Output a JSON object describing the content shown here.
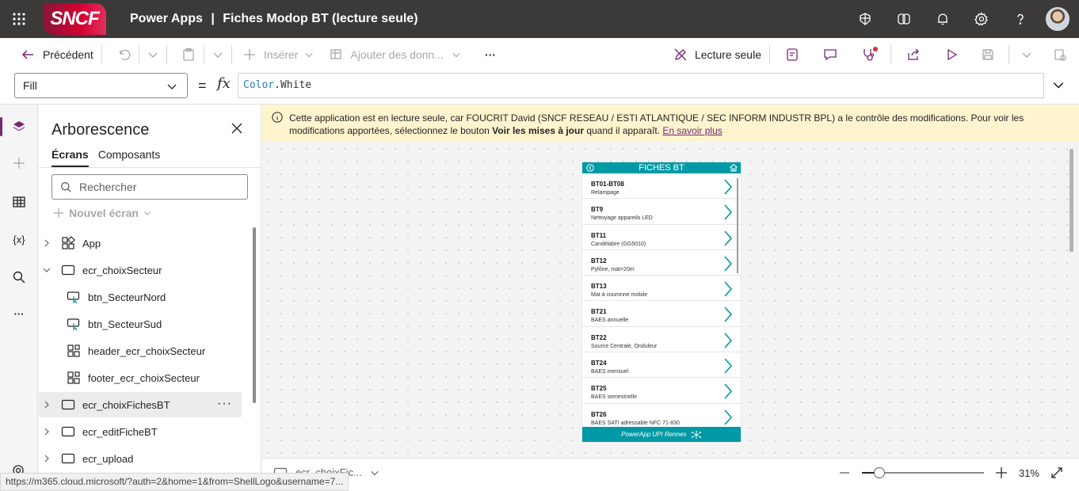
{
  "topbar": {
    "logo_text": "SNCF",
    "app_name": "Power Apps",
    "separator": "|",
    "doc_title": "Fiches Modop BT (lecture seule)"
  },
  "commandbar": {
    "back_label": "Précédent",
    "insert_label": "Insérer",
    "add_data_label": "Ajouter des donn...",
    "more_label": "···",
    "readonly_label": "Lecture seule"
  },
  "formulabar": {
    "property": "Fill",
    "equals": "=",
    "fx": "fx",
    "formula_obj": "Color",
    "formula_rest": ".White"
  },
  "tree": {
    "title": "Arborescence",
    "tabs": [
      "Écrans",
      "Composants"
    ],
    "search_placeholder": "Rechercher",
    "new_screen": "Nouvel écran",
    "nodes": [
      {
        "label": "App"
      },
      {
        "label": "ecr_choixSecteur"
      },
      {
        "label": "btn_SecteurNord"
      },
      {
        "label": "btn_SecteurSud"
      },
      {
        "label": "header_ecr_choixSecteur"
      },
      {
        "label": "footer_ecr_choixSecteur"
      },
      {
        "label": "ecr_choixFichesBT"
      },
      {
        "label": "ecr_editFicheBT"
      },
      {
        "label": "ecr_upload"
      }
    ],
    "more_label": "···"
  },
  "banner": {
    "text_before": "Cette application est en lecture seule, car FOUCRIT David (SNCF RESEAU / ESTI ATLANTIQUE / SEC INFORM INDUSTR BPL) a le contrôle des modifications. Pour voir les modifications apportées, sélectionnez le bouton ",
    "bold": "Voir les mises à jour",
    "text_after": " quand il apparaît. ",
    "link": "En savoir plus"
  },
  "phone": {
    "title": "FICHES BT",
    "footer": "PowerApp UPI Rennes",
    "rows": [
      {
        "code": "BT01-BT08",
        "desc": "Relampage"
      },
      {
        "code": "BT9",
        "desc": "Nettoyage appareils LED"
      },
      {
        "code": "BT11",
        "desc": "Candélabre (GG5010)"
      },
      {
        "code": "BT12",
        "desc": "Pylône, mat>20m"
      },
      {
        "code": "BT13",
        "desc": "Mat à couronne mobile"
      },
      {
        "code": "BT21",
        "desc": "BAES annuelle"
      },
      {
        "code": "BT22",
        "desc": "Source Centrale, Onduleur"
      },
      {
        "code": "BT24",
        "desc": "BAES mensuel"
      },
      {
        "code": "BT25",
        "desc": "BAES semestrielle"
      },
      {
        "code": "BT26",
        "desc": "BAES SATI adressable NFC 71-830"
      }
    ]
  },
  "bottombar": {
    "screen_name": "ecr_choixFic...",
    "zoom": "31%",
    "zoom_fraction": 0.14
  },
  "status_url": "https://m365.cloud.microsoft/?auth=2&home=1&from=ShellLogo&username=7...",
  "colors": {
    "topbar": "#3b3a39",
    "accent": "#742774",
    "app_teal": "#009aa6",
    "banner": "#fff4ce"
  }
}
